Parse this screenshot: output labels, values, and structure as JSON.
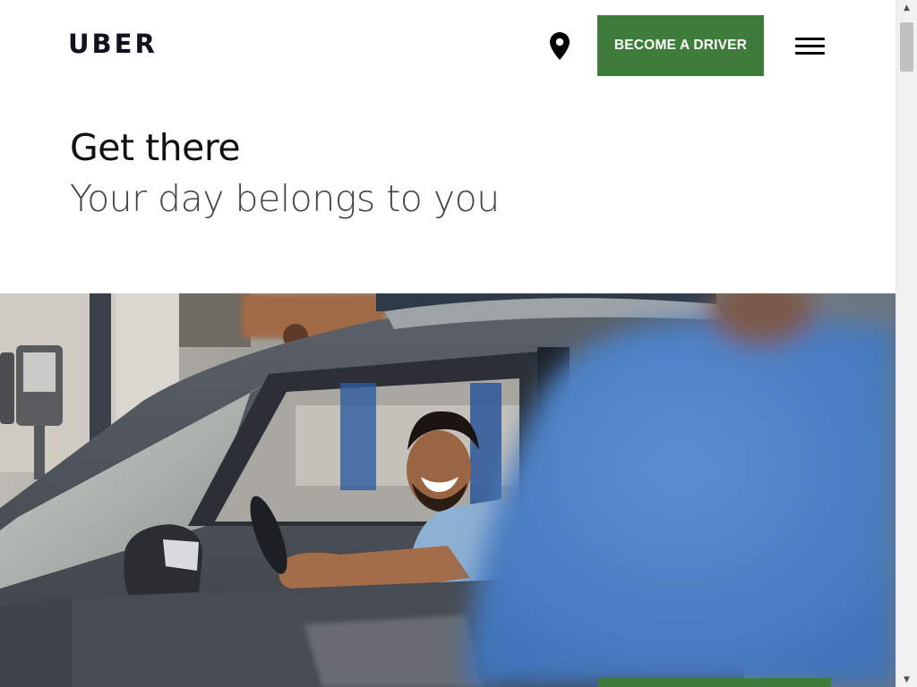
{
  "brand": {
    "logo_text": "UBER",
    "accent_color": "#3e7c3b"
  },
  "header": {
    "location_icon": "map-pin-icon",
    "driver_button_label": "BECOME A DRIVER",
    "menu_icon": "hamburger-menu-icon"
  },
  "hero": {
    "headline": "Get there",
    "subheadline": "Your day belongs to you",
    "image": "driver-smiling-in-car-photo"
  },
  "scrollbar": {
    "up_glyph": "▲",
    "down_glyph": "▼"
  }
}
